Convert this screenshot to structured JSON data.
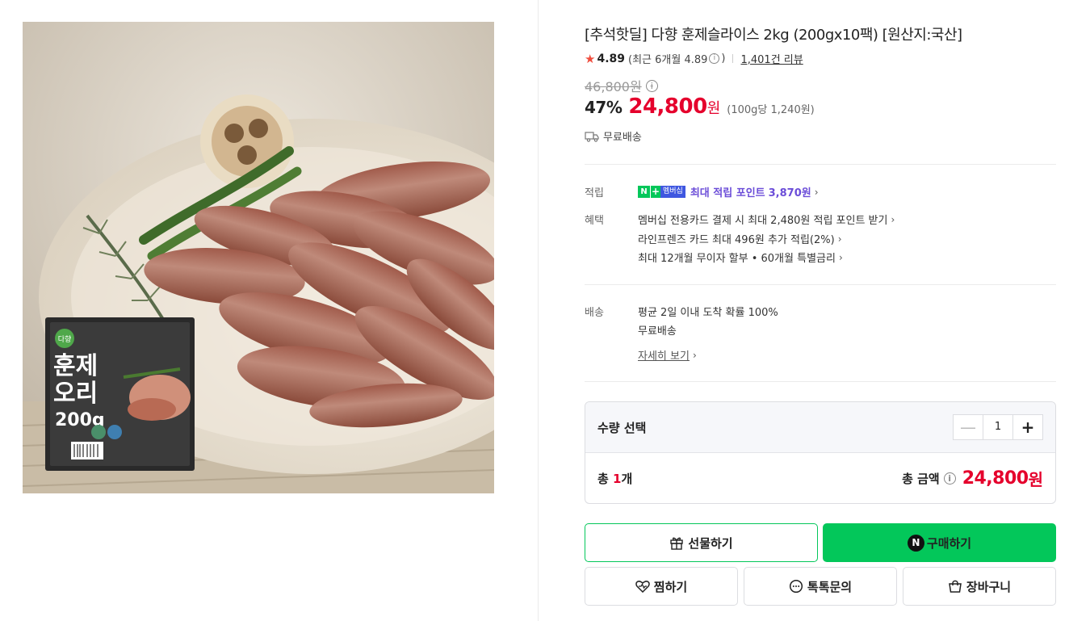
{
  "product": {
    "title": "[추석핫딜] 다향 훈제슬라이스 2kg (200gx10팩) [원산지:국산]",
    "rating": "4.89",
    "rating_recent": "(최근 6개월 4.89",
    "rating_close": ")",
    "review_count": "1,401건 리뷰",
    "original_price": "46,800원",
    "discount": "47%",
    "sale_price": "24,800",
    "won": "원",
    "unit_price": "(100g당 1,240원)",
    "shipping": "무료배송",
    "image": {
      "package_logo": "다향",
      "package_title_1": "훈제",
      "package_title_2": "오리",
      "package_weight": "200g"
    }
  },
  "benefits": {
    "points_label": "적립",
    "badge_n": "N",
    "badge_plus": "+",
    "badge_text": "멤버십",
    "points_link": "최대 적립 포인트",
    "points_value": "3,870원",
    "benefit_label": "혜택",
    "benefit_1": "멤버십 전용카드 결제 시 최대 2,480원 적립 포인트 받기",
    "benefit_2": "라인프렌즈 카드 최대 496원 추가 적립(2%)",
    "benefit_3": "최대 12개월 무이자 할부 • 60개월 특별금리",
    "delivery_label": "배송",
    "delivery_1": "평균 2일 이내 도착 확률 100%",
    "delivery_2": "무료배송",
    "delivery_more": "자세히 보기"
  },
  "quantity": {
    "label": "수량 선택",
    "value": "1",
    "total_prefix": "총 ",
    "total_num": "1",
    "total_suffix": "개",
    "total_amount_label": "총 금액",
    "total_price": "24,800",
    "total_won": "원"
  },
  "buttons": {
    "gift": "선물하기",
    "buy": "구매하기",
    "npay_letter": "N",
    "wish": "찜하기",
    "talk": "톡톡문의",
    "cart": "장바구니"
  },
  "colors": {
    "accent_red": "#e5002c",
    "naver_green": "#03c75a",
    "membership_purple": "#6b4dd8"
  }
}
